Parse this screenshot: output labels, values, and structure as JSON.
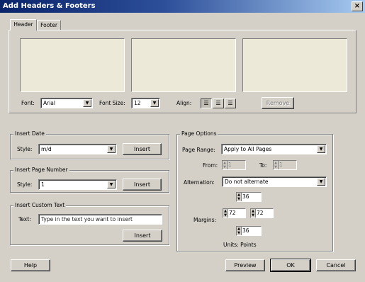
{
  "window": {
    "title": "Add Headers & Footers",
    "close_glyph": "×"
  },
  "tabs": [
    {
      "label": "Header",
      "active": true
    },
    {
      "label": "Footer",
      "active": false
    }
  ],
  "header_panel": {
    "font_label": "Font:",
    "font_value": "Arial",
    "font_size_label": "Font Size:",
    "font_size_value": "12",
    "align_label": "Align:",
    "align_icons": [
      "align-left-icon",
      "align-center-icon",
      "align-right-icon"
    ],
    "remove_label": "Remove"
  },
  "insert_date": {
    "legend": "Insert Date",
    "style_label": "Style:",
    "style_value": "m/d",
    "insert_label": "Insert"
  },
  "insert_page_number": {
    "legend": "Insert Page Number",
    "style_label": "Style:",
    "style_value": "1",
    "insert_label": "Insert"
  },
  "insert_custom_text": {
    "legend": "Insert Custom Text",
    "text_label": "Text:",
    "text_value": "Type in the text you want to insert",
    "insert_label": "Insert"
  },
  "page_options": {
    "legend": "Page Options",
    "page_range_label": "Page Range:",
    "page_range_value": "Apply to All Pages",
    "from_label": "From:",
    "from_value": "1",
    "to_label": "To:",
    "to_value": "1",
    "alternation_label": "Alternation:",
    "alternation_value": "Do not alternate",
    "margins_label": "Margins:",
    "margin_top": "36",
    "margin_left": "72",
    "margin_right": "72",
    "margin_bottom": "36",
    "units_label": "Units: Points"
  },
  "footer_buttons": {
    "help": "Help",
    "preview": "Preview",
    "ok": "OK",
    "cancel": "Cancel"
  }
}
